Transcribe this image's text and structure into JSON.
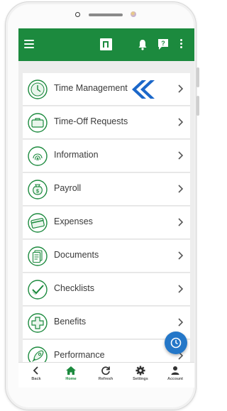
{
  "colors": {
    "brand": "#1c8a3e",
    "fab": "#2477c8",
    "pointer": "#1b67c9"
  },
  "header": {
    "menu_icon": "hamburger-icon",
    "logo_icon": "app-logo",
    "bell_icon": "bell-icon",
    "help_icon": "help-chat-icon",
    "more_icon": "more-vert-icon"
  },
  "menu": {
    "items": [
      {
        "label": "Time Management",
        "icon": "clock-icon"
      },
      {
        "label": "Time-Off Requests",
        "icon": "suitcase-icon"
      },
      {
        "label": "Information",
        "icon": "fingerprint-icon"
      },
      {
        "label": "Payroll",
        "icon": "money-bag-icon"
      },
      {
        "label": "Expenses",
        "icon": "credit-card-icon"
      },
      {
        "label": "Documents",
        "icon": "documents-icon"
      },
      {
        "label": "Checklists",
        "icon": "checklist-icon"
      },
      {
        "label": "Benefits",
        "icon": "medical-cross-icon"
      },
      {
        "label": "Performance",
        "icon": "rocket-icon"
      }
    ]
  },
  "fab": {
    "icon": "clock-icon"
  },
  "bottom_nav": {
    "items": [
      {
        "label": "Back",
        "icon": "chevron-left-icon"
      },
      {
        "label": "Home",
        "icon": "home-icon"
      },
      {
        "label": "Refresh",
        "icon": "refresh-icon"
      },
      {
        "label": "Settings",
        "icon": "gear-icon"
      },
      {
        "label": "Account",
        "icon": "person-icon"
      }
    ]
  }
}
